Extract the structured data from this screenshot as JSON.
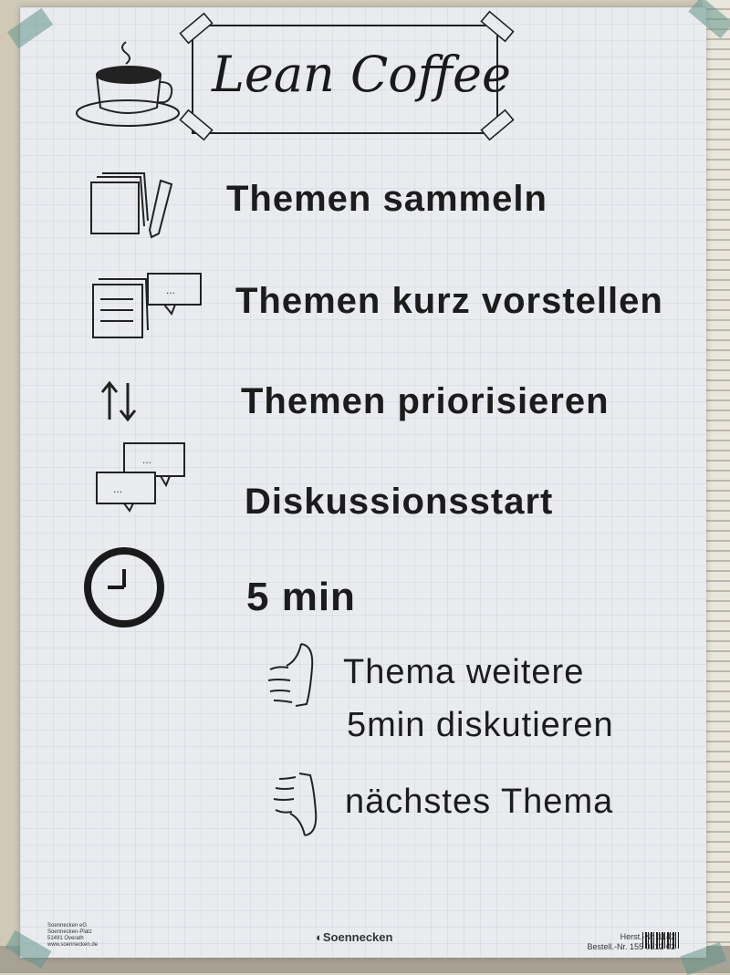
{
  "poster": {
    "title": "Lean Coffee",
    "steps": [
      {
        "label": "Themen sammeln"
      },
      {
        "label": "Themen kurz vorstellen"
      },
      {
        "label": "Themen priorisieren"
      },
      {
        "label": "Diskussionsstart"
      },
      {
        "label": "5 min"
      }
    ],
    "substeps": [
      {
        "line1": "Thema weitere",
        "line2": "5min diskutieren"
      },
      {
        "line1": "nächstes Thema"
      }
    ]
  },
  "footer": {
    "address_lines": [
      "Soennecken eG",
      "Soennecken-Platz",
      "51491 Overath",
      "www.soennecken.de"
    ],
    "brand": "Soennecken",
    "herst": "Herst.-Nr. 1142",
    "bestell": "Bestell.-Nr. 155 0212 02"
  },
  "colors": {
    "ink": "#1c1c1c",
    "paper": "#e9ebef",
    "tape": "#6a9a8c"
  }
}
